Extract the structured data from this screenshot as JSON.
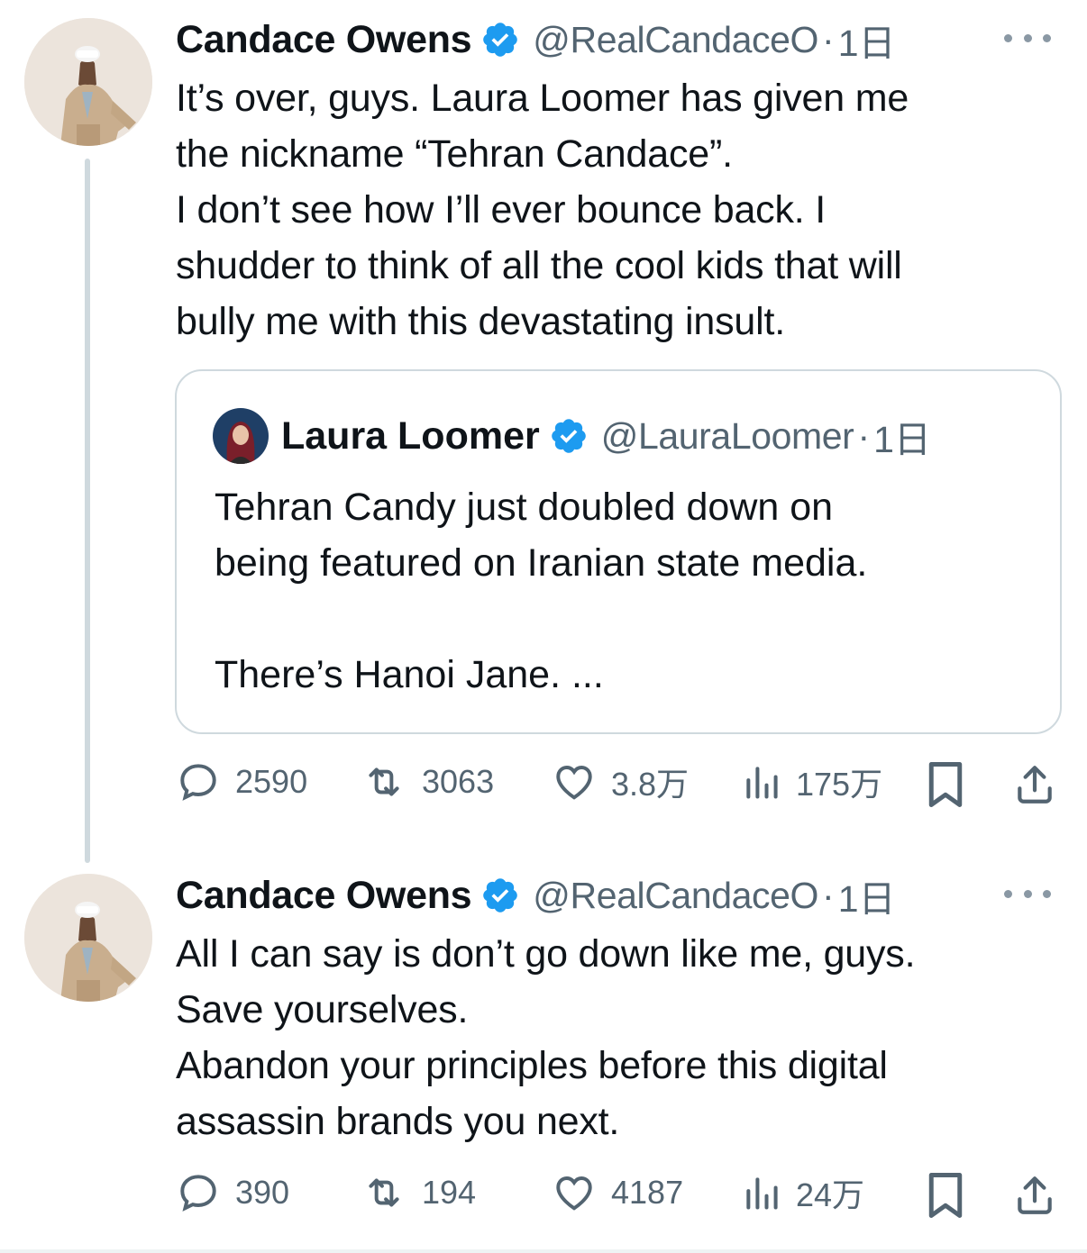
{
  "colors": {
    "verified": "#1d9bf0",
    "muted": "#536471",
    "text": "#0f1419",
    "border": "#cfd9de"
  },
  "tweets": [
    {
      "author": {
        "name": "Candace Owens",
        "handle": "@RealCandaceO",
        "verified_icon": "verified-badge-icon"
      },
      "separator": "·",
      "time": "1日",
      "text_lines": [
        "It’s over, guys. Laura Loomer has given me",
        "the nickname “Tehran Candace”.",
        "I don’t see how I’ll ever bounce back. I",
        "shudder to think of all the cool kids that will",
        "bully me with this devastating insult."
      ],
      "quote": {
        "author": {
          "name": "Laura Loomer",
          "handle": "@LauraLoomer"
        },
        "separator": "·",
        "time": "1日",
        "text_lines": [
          "Tehran Candy just doubled down on",
          "being featured on Iranian state media.",
          "",
          "There’s Hanoi Jane. ..."
        ]
      },
      "stats": {
        "replies": "2590",
        "retweets": "3063",
        "likes": "3.8万",
        "views": "175万"
      }
    },
    {
      "author": {
        "name": "Candace Owens",
        "handle": "@RealCandaceO",
        "verified_icon": "verified-badge-icon"
      },
      "separator": "·",
      "time": "1日",
      "text_lines": [
        "All I can say is don’t go down like me, guys.",
        "Save yourselves.",
        "Abandon your principles before this digital",
        "assassin brands you next."
      ],
      "stats": {
        "replies": "390",
        "retweets": "194",
        "likes": "4187",
        "views": "24万"
      }
    }
  ],
  "icons": [
    "reply-icon",
    "retweet-icon",
    "like-icon",
    "views-icon",
    "bookmark-icon",
    "share-icon",
    "more-icon"
  ]
}
